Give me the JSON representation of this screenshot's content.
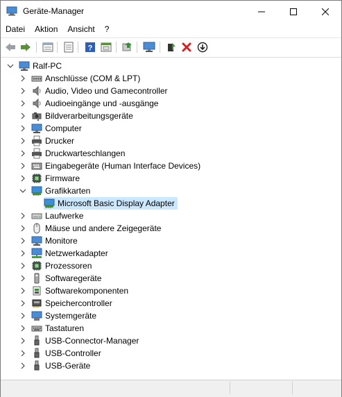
{
  "window": {
    "title": "Geräte-Manager"
  },
  "menu": [
    "Datei",
    "Aktion",
    "Ansicht",
    "?"
  ],
  "toolbar": [
    {
      "name": "back-icon"
    },
    {
      "name": "forward-icon"
    },
    {
      "name": "properties-view-icon"
    },
    {
      "name": "details-icon"
    },
    {
      "name": "help-icon"
    },
    {
      "name": "show-hidden-icon"
    },
    {
      "name": "update-driver-icon"
    },
    {
      "name": "scan-hardware-icon"
    },
    {
      "name": "enable-device-icon"
    },
    {
      "name": "uninstall-icon"
    },
    {
      "name": "download-driver-icon"
    }
  ],
  "tree": {
    "root": "Ralf-PC",
    "categories": [
      {
        "label": "Anschlüsse (COM & LPT)",
        "icon": "port-icon"
      },
      {
        "label": "Audio, Video und Gamecontroller",
        "icon": "speaker-icon"
      },
      {
        "label": "Audioeingänge und -ausgänge",
        "icon": "speaker-icon"
      },
      {
        "label": "Bildverarbeitungsgeräte",
        "icon": "camera-icon"
      },
      {
        "label": "Computer",
        "icon": "computer-icon"
      },
      {
        "label": "Drucker",
        "icon": "printer-icon"
      },
      {
        "label": "Druckwarteschlangen",
        "icon": "printer-icon"
      },
      {
        "label": "Eingabegeräte (Human Interface Devices)",
        "icon": "hid-icon"
      },
      {
        "label": "Firmware",
        "icon": "chip-icon"
      },
      {
        "label": "Grafikkarten",
        "icon": "display-adapter-icon",
        "expanded": true,
        "children": [
          {
            "label": "Microsoft Basic Display Adapter",
            "icon": "display-adapter-icon"
          }
        ]
      },
      {
        "label": "Laufwerke",
        "icon": "drive-icon"
      },
      {
        "label": "Mäuse und andere Zeigegeräte",
        "icon": "mouse-icon"
      },
      {
        "label": "Monitore",
        "icon": "monitor-icon"
      },
      {
        "label": "Netzwerkadapter",
        "icon": "network-icon"
      },
      {
        "label": "Prozessoren",
        "icon": "processor-icon"
      },
      {
        "label": "Softwaregeräte",
        "icon": "software-device-icon"
      },
      {
        "label": "Softwarekomponenten",
        "icon": "software-component-icon"
      },
      {
        "label": "Speichercontroller",
        "icon": "storage-controller-icon"
      },
      {
        "label": "Systemgeräte",
        "icon": "system-devices-icon"
      },
      {
        "label": "Tastaturen",
        "icon": "keyboard-icon"
      },
      {
        "label": "USB-Connector-Manager",
        "icon": "usb-icon"
      },
      {
        "label": "USB-Controller",
        "icon": "usb-icon"
      },
      {
        "label": "USB-Geräte",
        "icon": "usb-icon"
      }
    ]
  }
}
